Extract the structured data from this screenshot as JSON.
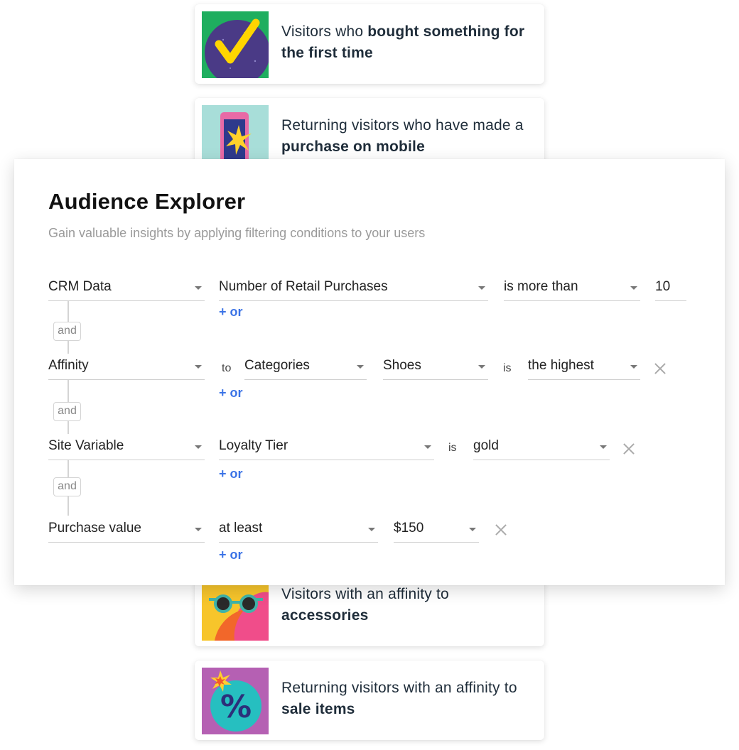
{
  "cards": [
    {
      "text_normal": "Visitors who ",
      "text_bold": "bought something for the first time",
      "icon": "checkmark-icon"
    },
    {
      "text_normal": "Returning visitors who have made a ",
      "text_bold": "purchase on mobile",
      "icon": "mobile-phone-icon"
    },
    {
      "text_normal": "Visitors with an affinity to ",
      "text_bold": "accessories",
      "icon": "sunglasses-icon"
    },
    {
      "text_normal": "Returning visitors with an affinity to ",
      "text_bold": "sale items",
      "icon": "percent-icon"
    }
  ],
  "panel": {
    "title": "Audience Explorer",
    "subtitle": "Gain valuable insights by applying filtering conditions to your users",
    "and_label": "and",
    "or_label": "+ or",
    "rows": [
      {
        "source": "CRM Data",
        "field": "Number of Retail Purchases",
        "operator": "is more than",
        "value": "10"
      },
      {
        "source": "Affinity",
        "to_label": "to",
        "field": "Categories",
        "value": "Shoes",
        "is_label": "is",
        "operator": "the highest"
      },
      {
        "source": "Site Variable",
        "field": "Loyalty Tier",
        "is_label": "is",
        "value": "gold"
      },
      {
        "source": "Purchase value",
        "operator": "at least",
        "value": "$150"
      }
    ]
  },
  "colors": {
    "link": "#3b73e6",
    "text": "#1f2d3a",
    "subtitle": "#9a9a9a",
    "border": "#cfcfcf"
  }
}
